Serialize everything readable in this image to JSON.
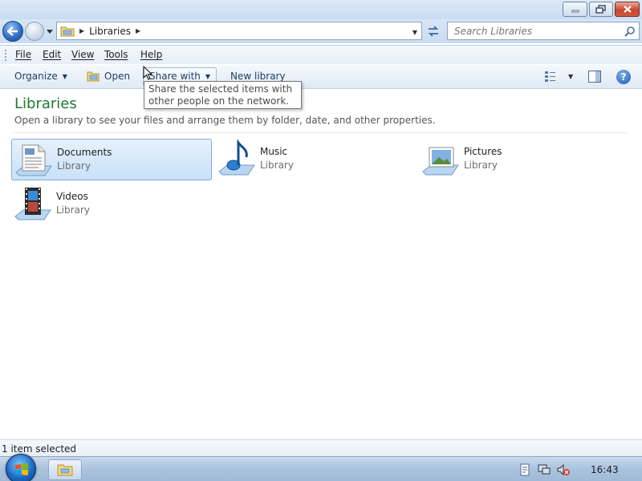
{
  "window": {
    "caption_buttons": {
      "minimize": "minimize-icon",
      "maximize": "restore-icon",
      "close": "close-icon"
    }
  },
  "nav": {
    "back_icon": "back-arrow-icon",
    "forward_icon": "forward-arrow-icon",
    "address": {
      "folder_icon": "libraries-folder-icon",
      "path": "Libraries"
    },
    "refresh_icon": "refresh-icon",
    "search": {
      "placeholder": "Search Libraries",
      "icon": "search-icon"
    }
  },
  "menu": {
    "items": [
      {
        "label": "File"
      },
      {
        "label": "Edit"
      },
      {
        "label": "View"
      },
      {
        "label": "Tools"
      },
      {
        "label": "Help"
      }
    ]
  },
  "commands": {
    "organize": "Organize",
    "open": "Open",
    "share_with": "Share with",
    "new_library": "New library",
    "view_icon": "change-view-icon",
    "preview_pane_icon": "preview-pane-icon",
    "help_icon": "help-icon"
  },
  "tooltip": {
    "text": "Share the selected items with other people on the network."
  },
  "content": {
    "title": "Libraries",
    "subtitle": "Open a library to see your files and arrange them by folder, date, and other properties.",
    "libraries": [
      {
        "name": "Documents",
        "type": "Library",
        "icon": "documents-library-icon",
        "selected": true
      },
      {
        "name": "Music",
        "type": "Library",
        "icon": "music-library-icon",
        "selected": false
      },
      {
        "name": "Pictures",
        "type": "Library",
        "icon": "pictures-library-icon",
        "selected": false
      },
      {
        "name": "Videos",
        "type": "Library",
        "icon": "videos-library-icon",
        "selected": false
      }
    ]
  },
  "status": {
    "text": "1 item selected"
  },
  "taskbar": {
    "start_icon": "windows-start-icon",
    "explorer_icon": "explorer-folder-icon",
    "tray": [
      "action-center-icon",
      "network-icon",
      "volume-muted-icon"
    ],
    "clock": "16:43"
  },
  "colors": {
    "accent_title": "#1e7a32",
    "selection": "#c9e1f9",
    "taskbar": "#aac3de"
  }
}
